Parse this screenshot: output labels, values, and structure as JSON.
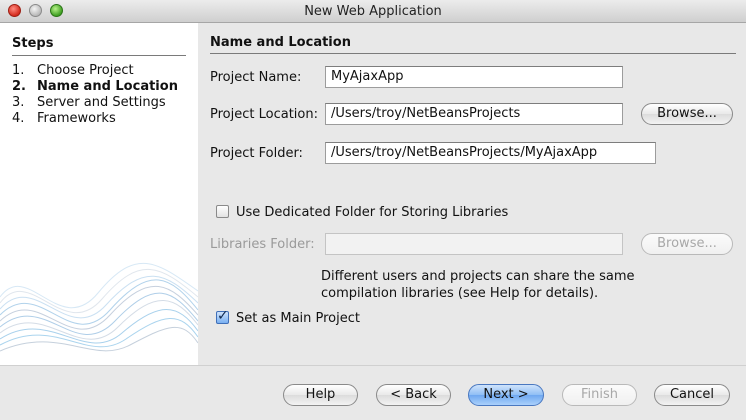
{
  "window": {
    "title": "New Web Application"
  },
  "steps": {
    "heading": "Steps",
    "items": [
      {
        "num": "1.",
        "label": "Choose Project"
      },
      {
        "num": "2.",
        "label": "Name and Location"
      },
      {
        "num": "3.",
        "label": "Server and Settings"
      },
      {
        "num": "4.",
        "label": "Frameworks"
      }
    ],
    "current_index": 1
  },
  "form": {
    "heading": "Name and Location",
    "project_name_label": "Project Name:",
    "project_name_value": "MyAjaxApp",
    "project_location_label": "Project Location:",
    "project_location_value": "/Users/troy/NetBeansProjects",
    "browse_label": "Browse...",
    "project_folder_label": "Project Folder:",
    "project_folder_value": "/Users/troy/NetBeansProjects/MyAjaxApp",
    "dedicated_folder_label": "Use Dedicated Folder for Storing Libraries",
    "dedicated_folder_checked": false,
    "libraries_folder_label": "Libraries Folder:",
    "libraries_folder_value": "",
    "libraries_browse_label": "Browse...",
    "help_line1": "Different users and projects can share the same",
    "help_line2": "compilation libraries (see Help for details).",
    "main_project_label": "Set as Main Project",
    "main_project_checked": true
  },
  "buttons": {
    "help": "Help",
    "back": "< Back",
    "next": "Next >",
    "finish": "Finish",
    "cancel": "Cancel"
  }
}
